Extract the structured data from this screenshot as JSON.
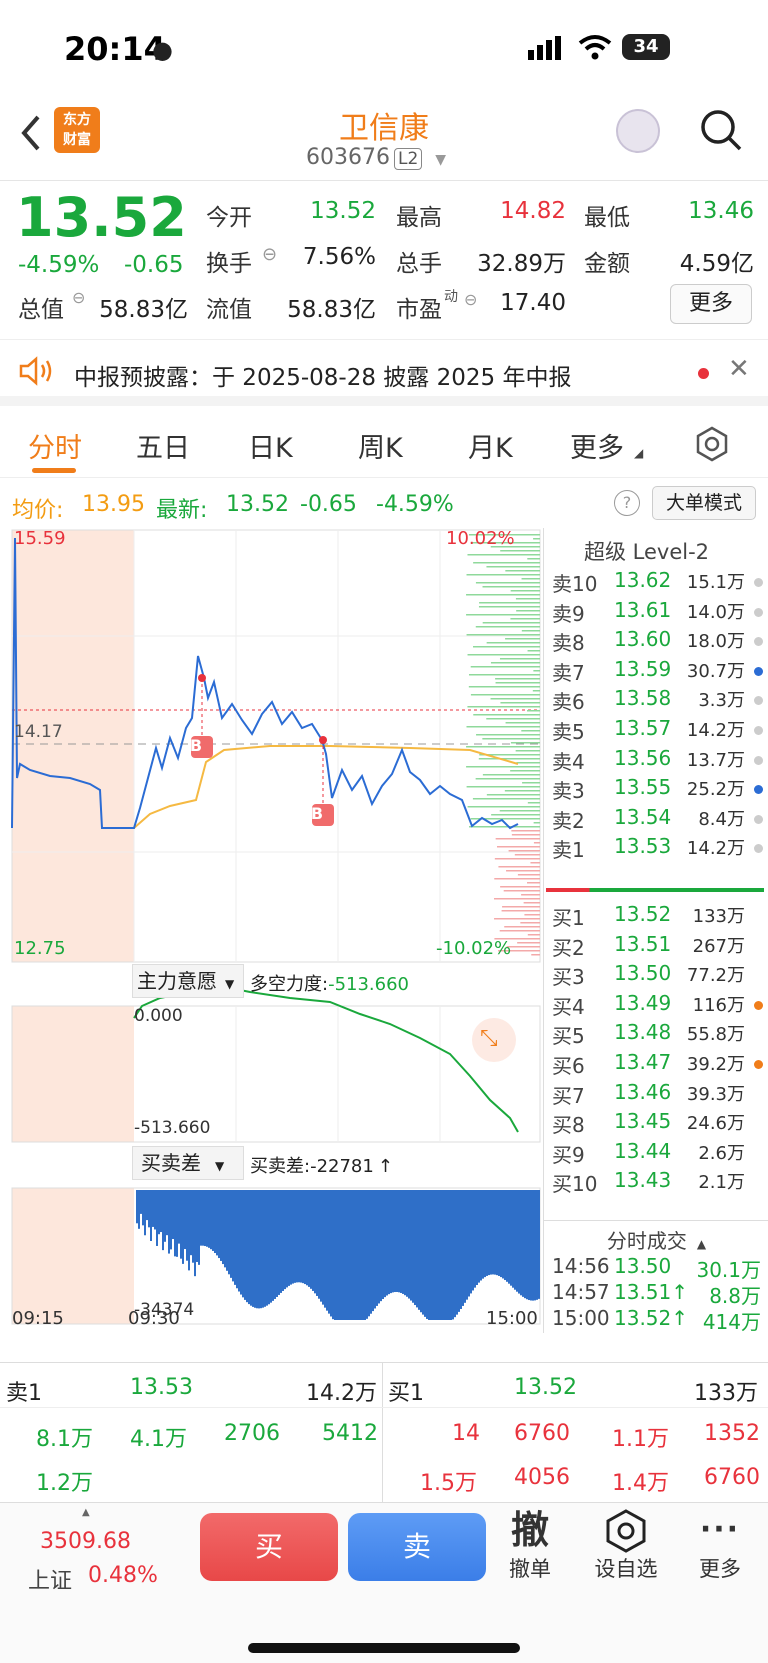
{
  "status": {
    "time": "20:14",
    "battery": "34"
  },
  "header": {
    "name": "卫信康",
    "code": "603676",
    "level_badge": "L2",
    "logo_text_1": "东方",
    "logo_text_2": "财富"
  },
  "quote": {
    "price": "13.52",
    "change_pct": "-4.59%",
    "change": "-0.65",
    "open_label": "今开",
    "open": "13.52",
    "high_label": "最高",
    "high": "14.82",
    "low_label": "最低",
    "low": "13.46",
    "turnover_label": "换手",
    "turnover": "7.56%",
    "volume_label": "总手",
    "volume": "32.89万",
    "amount_label": "金额",
    "amount": "4.59亿",
    "mktcap_label": "总值",
    "mktcap": "58.83亿",
    "float_label": "流值",
    "float": "58.83亿",
    "pe_label": "市盈",
    "pe_sup": "动",
    "pe": "17.40",
    "more": "更多"
  },
  "notice": {
    "text": "中报预披露：于 2025-08-28 披露 2025 年中报"
  },
  "tabs": [
    "分时",
    "五日",
    "日K",
    "周K",
    "月K",
    "更多"
  ],
  "inforow": {
    "avg_label": "均价:",
    "avg": "13.95",
    "last_label": "最新:",
    "last": "13.52",
    "chg": "-0.65",
    "pct": "-4.59%",
    "mode": "大单模式"
  },
  "chart": {
    "top_price": "15.59",
    "top_pct": "10.02%",
    "mid_price": "14.17",
    "bot_price": "12.75",
    "bot_pct": "-10.02%",
    "ind1_name": "主力意愿",
    "ind1_label": "多空力度:",
    "ind1_val": "-513.660",
    "ind1_top": "0.000",
    "ind1_bot": "-513.660",
    "ind2_name": "买卖差",
    "ind2_label": "买卖差:",
    "ind2_val": "-22781",
    "ind2_arrow": "↑",
    "ind2_bot": "-34374",
    "time_start": "09:15",
    "time_open": "09:30",
    "time_end": "15:00",
    "b_marker": "B"
  },
  "book": {
    "title": "超级 Level-2",
    "sells": [
      {
        "label": "卖10",
        "price": "13.62",
        "vol": "15.1万",
        "dot": "#ccc"
      },
      {
        "label": "卖9",
        "price": "13.61",
        "vol": "14.0万",
        "dot": "#ccc"
      },
      {
        "label": "卖8",
        "price": "13.60",
        "vol": "18.0万",
        "dot": "#ccc"
      },
      {
        "label": "卖7",
        "price": "13.59",
        "vol": "30.7万",
        "dot": "#2b6cd4"
      },
      {
        "label": "卖6",
        "price": "13.58",
        "vol": "3.3万",
        "dot": "#ccc"
      },
      {
        "label": "卖5",
        "price": "13.57",
        "vol": "14.2万",
        "dot": "#ccc"
      },
      {
        "label": "卖4",
        "price": "13.56",
        "vol": "13.7万",
        "dot": "#ccc"
      },
      {
        "label": "卖3",
        "price": "13.55",
        "vol": "25.2万",
        "dot": "#2b6cd4"
      },
      {
        "label": "卖2",
        "price": "13.54",
        "vol": "8.4万",
        "dot": "#ccc"
      },
      {
        "label": "卖1",
        "price": "13.53",
        "vol": "14.2万",
        "dot": "#ccc"
      }
    ],
    "buys": [
      {
        "label": "买1",
        "price": "13.52",
        "vol": "133万",
        "dot": "none"
      },
      {
        "label": "买2",
        "price": "13.51",
        "vol": "267万",
        "dot": "none"
      },
      {
        "label": "买3",
        "price": "13.50",
        "vol": "77.2万",
        "dot": "none"
      },
      {
        "label": "买4",
        "price": "13.49",
        "vol": "116万",
        "dot": "#f07d1a"
      },
      {
        "label": "买5",
        "price": "13.48",
        "vol": "55.8万",
        "dot": "none"
      },
      {
        "label": "买6",
        "price": "13.47",
        "vol": "39.2万",
        "dot": "#f07d1a"
      },
      {
        "label": "买7",
        "price": "13.46",
        "vol": "39.3万",
        "dot": "none"
      },
      {
        "label": "买8",
        "price": "13.45",
        "vol": "24.6万",
        "dot": "none"
      },
      {
        "label": "买9",
        "price": "13.44",
        "vol": "2.6万",
        "dot": "none"
      },
      {
        "label": "买10",
        "price": "13.43",
        "vol": "2.1万",
        "dot": "none"
      }
    ],
    "ticks_title": "分时成交",
    "ticks": [
      {
        "time": "14:56",
        "price": "13.50",
        "vol": "30.1万"
      },
      {
        "time": "14:57",
        "price": "13.51↑",
        "vol": "8.8万"
      },
      {
        "time": "15:00",
        "price": "13.52↑",
        "vol": "414万"
      }
    ]
  },
  "bottominfo": {
    "sell_label": "卖1",
    "sell_price": "13.53",
    "sell_vol": "14.2万",
    "buy_label": "买1",
    "buy_price": "13.52",
    "buy_vol": "133万",
    "sell_queue": [
      "8.1万",
      "4.1万",
      "2706",
      "5412",
      "1.2万"
    ],
    "buy_queue": [
      "14",
      "6760",
      "1.1万",
      "1352",
      "1.5万",
      "4056",
      "1.4万",
      "6760"
    ]
  },
  "bottombar": {
    "index_value": "3509.68",
    "index_name": "上证",
    "index_pct": "0.48%",
    "buy": "买",
    "sell": "卖",
    "cancel_icon": "撤",
    "cancel": "撤单",
    "watch": "设自选",
    "more": "更多"
  },
  "colors": {
    "up": "#e8323c",
    "down": "#1aa83c",
    "brand": "#f07d1a",
    "line": "#2b6cd4",
    "avg": "#f5b942"
  }
}
